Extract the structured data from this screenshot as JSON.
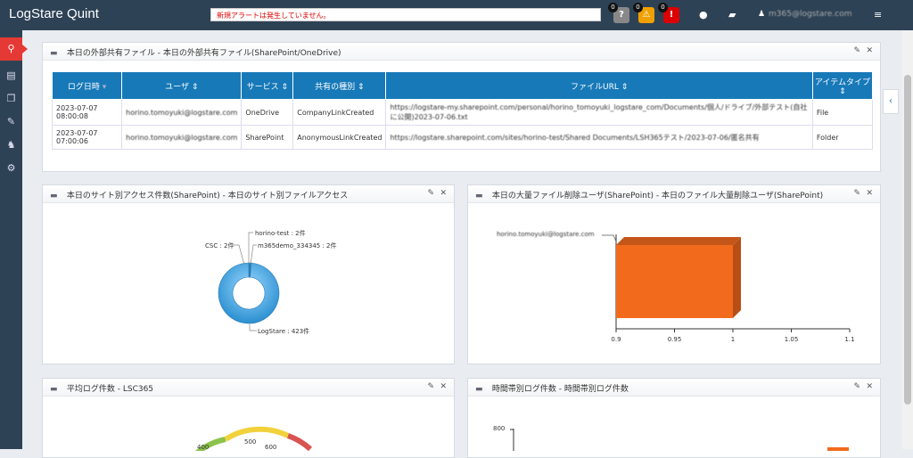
{
  "app": {
    "title": "LogStare Quint"
  },
  "header": {
    "alert_text": "新規アラートは発生していません。",
    "badges": [
      {
        "count": "0",
        "glyph": "?",
        "color": "#888888"
      },
      {
        "count": "0",
        "glyph": "⚠",
        "color": "#f0a000"
      },
      {
        "count": "0",
        "glyph": "!",
        "color": "#d00000"
      }
    ],
    "user": "m365@logstare.com"
  },
  "panel_files": {
    "title": "本日の外部共有ファイル - 本日の外部共有ファイル(SharePoint/OneDrive)",
    "columns": [
      "ログ日時",
      "ユーザ",
      "サービス",
      "共有の種別",
      "ファイルURL",
      "アイテムタイプ"
    ],
    "rows": [
      {
        "date": "2023-07-07",
        "time": "08:00:08",
        "user": "horino.tomoyuki@logstare.com",
        "service": "OneDrive",
        "kind": "CompanyLinkCreated",
        "url": "https://logstare-my.sharepoint.com/personal/horino_tomoyuki_logstare_com/Documents/個人/ドライブ/外部テスト(自社に公開)2023-07-06.txt",
        "type": "File"
      },
      {
        "date": "2023-07-07",
        "time": "07:00:06",
        "user": "horino.tomoyuki@logstare.com",
        "service": "SharePoint",
        "kind": "AnonymousLinkCreated",
        "url": "https://logstare.sharepoint.com/sites/horino-test/Shared Documents/LSH365テスト/2023-07-06/匿名共有",
        "type": "Folder"
      }
    ]
  },
  "panel_site": {
    "title": "本日のサイト別アクセス件数(SharePoint) - 本日のサイト別ファイルアクセス",
    "labels": [
      "horino-test : 2件",
      "CSC : 2件",
      "m365demo_334345 : 2件",
      "LogStare : 423件"
    ]
  },
  "panel_delete": {
    "title": "本日の大量ファイル削除ユーザ(SharePoint) - 本日のファイル大量削除ユーザ(SharePoint)",
    "user_label": "horino.tomoyuki@logstare.com",
    "ticks": [
      "0.9",
      "0.95",
      "1",
      "1.05",
      "1.1"
    ]
  },
  "panel_avg": {
    "title": "平均ログ件数 - LSC365",
    "gauge_ticks": [
      "400",
      "500",
      "600"
    ]
  },
  "panel_hourly": {
    "title": "時間帯別ログ件数 - 時間帯別ログ件数",
    "y_tick": "800"
  },
  "chart_data": [
    {
      "type": "pie",
      "categories": [
        "horino-test",
        "CSC",
        "m365demo_334345",
        "LogStare"
      ],
      "values": [
        2,
        2,
        2,
        423
      ]
    },
    {
      "type": "bar",
      "categories": [
        "horino.tomoyuki@logstare.com"
      ],
      "values": [
        1
      ],
      "xlim": [
        0.9,
        1.1
      ]
    }
  ]
}
